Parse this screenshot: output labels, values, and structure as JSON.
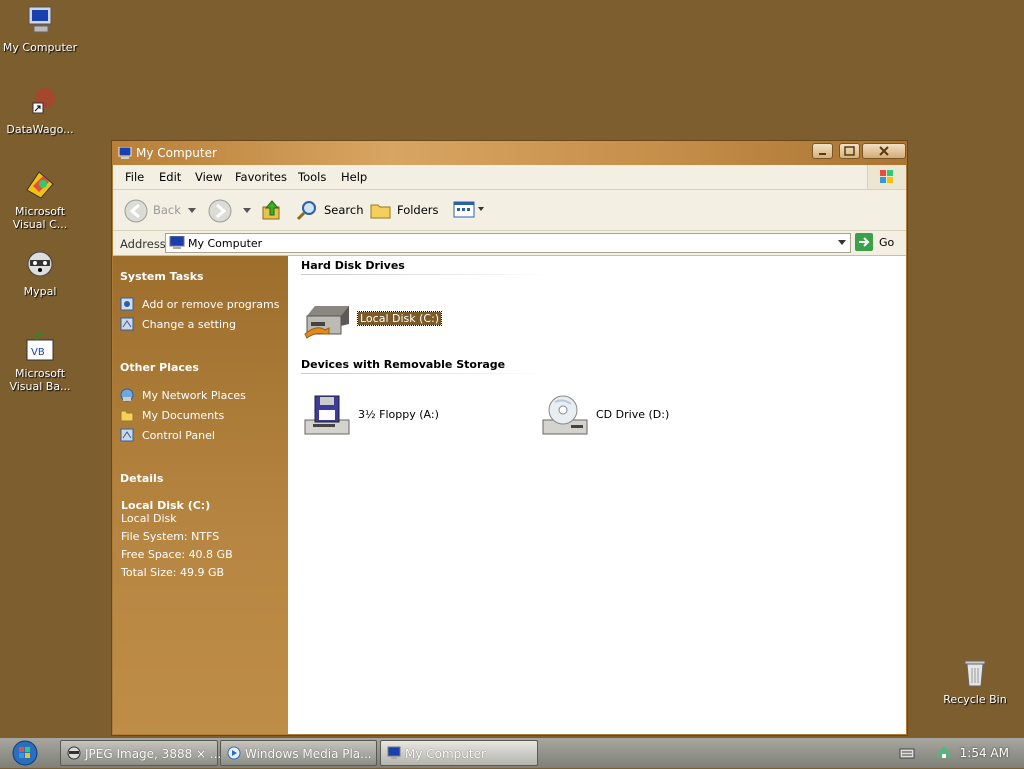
{
  "desktop": {
    "icons": [
      {
        "label": "My Computer"
      },
      {
        "label": "DataWago..."
      },
      {
        "label": "Microsoft Visual C..."
      },
      {
        "label": "Mypal"
      },
      {
        "label": "Microsoft Visual Ba..."
      },
      {
        "label": "Recycle Bin"
      }
    ]
  },
  "window": {
    "title": "My Computer",
    "menu": [
      "File",
      "Edit",
      "View",
      "Favorites",
      "Tools",
      "Help"
    ],
    "toolbar": {
      "back": "Back",
      "search": "Search",
      "folders": "Folders"
    },
    "address": {
      "label": "Address",
      "value": "My Computer",
      "go": "Go"
    }
  },
  "taskpane": {
    "system_tasks": {
      "title": "System Tasks",
      "items": [
        "Add or remove programs",
        "Change a setting"
      ]
    },
    "other_places": {
      "title": "Other Places",
      "items": [
        "My Network Places",
        "My Documents",
        "Control Panel"
      ]
    },
    "details": {
      "title": "Details",
      "name": "Local Disk (C:)",
      "type": "Local Disk",
      "file_system": "File System: NTFS",
      "free_space": "Free Space: 40.8 GB",
      "total_size": "Total Size: 49.9 GB"
    }
  },
  "content": {
    "groups": [
      {
        "title": "Hard Disk Drives",
        "items": [
          "Local Disk (C:)"
        ]
      },
      {
        "title": "Devices with Removable Storage",
        "items": [
          "3½ Floppy (A:)",
          "CD Drive (D:)"
        ]
      }
    ]
  },
  "taskbar": {
    "tasks": [
      "JPEG Image, 3888 × ...",
      "Windows Media Pla...",
      "My Computer"
    ],
    "clock": "1:54 AM"
  },
  "colors": {
    "desktop": "#7d5e2e",
    "accent": "#b07c35",
    "selection": "#7a5a26"
  }
}
